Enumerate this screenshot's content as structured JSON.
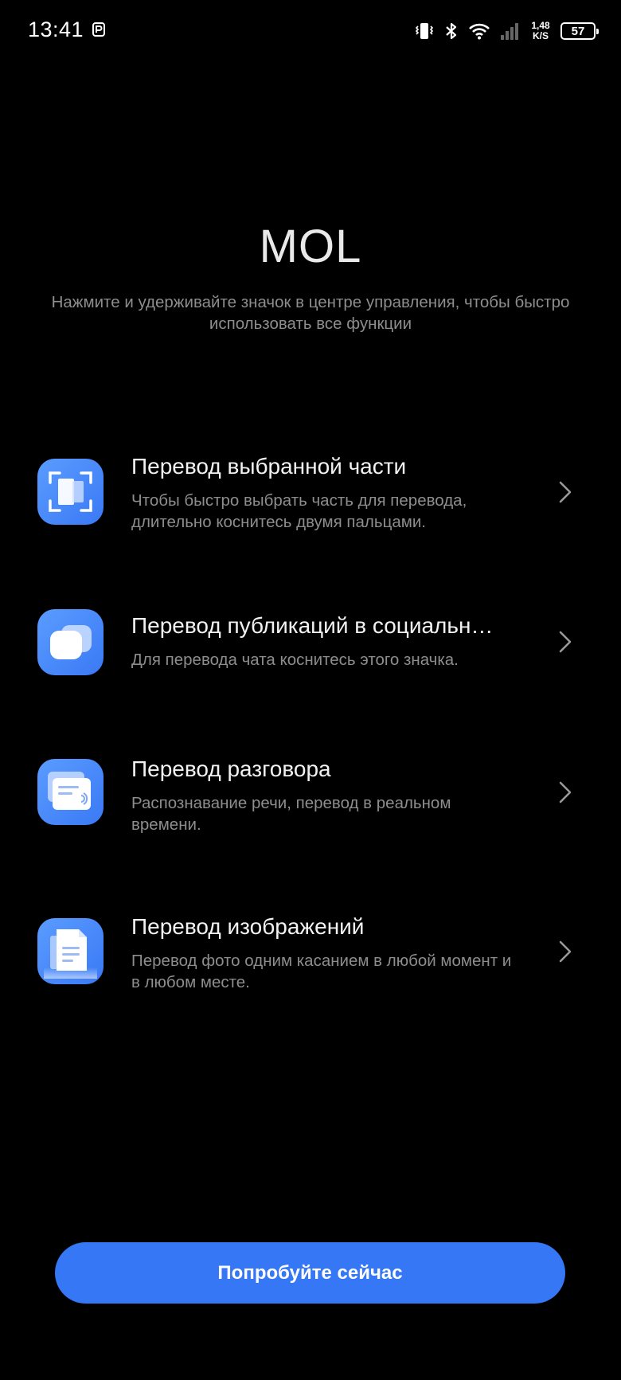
{
  "status_bar": {
    "time": "13:41",
    "net_speed_value": "1,48",
    "net_speed_unit": "K/S",
    "battery": "57",
    "icons": [
      "notification-p-icon",
      "vibrate-icon",
      "bluetooth-icon",
      "wifi-icon",
      "signal-icon",
      "battery-icon"
    ]
  },
  "header": {
    "title": "MOL",
    "subtitle": "Нажмите и удерживайте значок в центре управления, чтобы быстро использовать все функции"
  },
  "features": [
    {
      "icon": "selection-frame-icon",
      "title": "Перевод выбранной части",
      "description": "Чтобы быстро выбрать часть для перевода, длительно коснитесь двумя пальцами."
    },
    {
      "icon": "chat-bubbles-icon",
      "title": "Перевод публикаций в социальн…",
      "description": "Для перевода чата коснитесь этого значка."
    },
    {
      "icon": "conversation-cards-icon",
      "title": "Перевод разговора",
      "description": "Распознавание речи, перевод в реальном времени."
    },
    {
      "icon": "image-document-icon",
      "title": "Перевод изображений",
      "description": "Перевод фото одним касанием в любой момент и в любом месте."
    }
  ],
  "cta": {
    "label": "Попробуйте сейчас"
  },
  "colors": {
    "background": "#000000",
    "accent": "#3577f5",
    "icon_gradient_start": "#5a9cff",
    "icon_gradient_end": "#3a79f5",
    "secondary_text": "#8d8d8d"
  }
}
